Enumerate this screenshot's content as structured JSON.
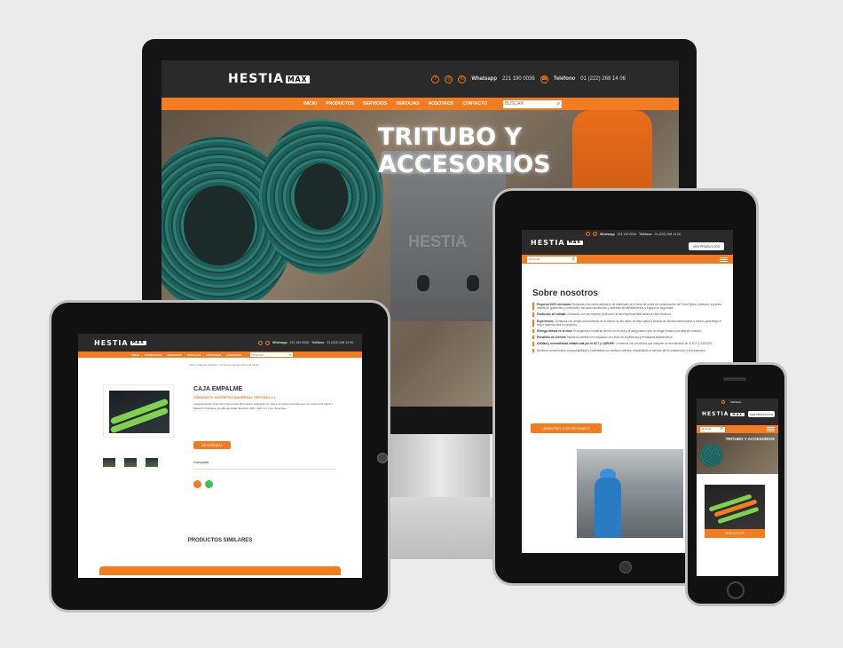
{
  "brand": {
    "logo": "HESTIA",
    "logo_mark": "MAX",
    "accent": "#f47c20"
  },
  "desktop": {
    "whatsapp_label": "Whatsapp",
    "whatsapp": "221 190 0036",
    "phone_label": "Teléfono",
    "phone": "01 (222) 268 14 06",
    "nav": [
      "INICIO",
      "PRODUCTOS",
      "SERVICIOS",
      "VENTAJAS",
      "NOSOTROS",
      "CONTACTO"
    ],
    "search_placeholder": "BUSCAR",
    "hero_title": "TRITUBO Y ACCESORIOS",
    "box_brand": "HESTIA"
  },
  "tablet_left": {
    "breadcrumb": "Inicio / Caja de Registro / Conjunto soporte universal tritubo",
    "product_title": "CAJA EMPALME",
    "product_subtitle": "CONJUNTO SOPORTE UNIVERSAL TRITUBO 4 1",
    "product_desc": "Características: Unión de tritubos para fibra óptica; aplicación en redes de telecomunicaciones con sistema de fijación. Material: Polietileno de alta densidad. Medidas: 300 x 200 mm. Uso: Enterrado.",
    "cta": "ME INTERESA",
    "share": "Compartir",
    "similar": "PRODUCTOS SIMILARES"
  },
  "tablet_right": {
    "catalog_button": "VER PRODUCTOS",
    "heading": "Sobre nosotros",
    "items": [
      {
        "title": "Empresa 100% mexicana:",
        "text": "Dedicada a la comercialización de materiales en el área de redes de comunicación de Fibra Óptica, plásticos, soportes metálicos, gabinetes y conectores; así como accesorios y sistemas de señalamientos y equipo de seguridad."
      },
      {
        "title": "Productos de calidad:",
        "text": "Contamos con las mejores productos de las empresas fabricantes a nivel nacional."
      },
      {
        "title": "Experiencia:",
        "text": "Contamos con amplio conocimiento en el diseño de las redes de fibra óptica y tendido de ductos subterráneos y aéreos para elegir el mejor material para su proyecto."
      },
      {
        "title": "Entrega directa en la obra:",
        "text": "Entregamos el material directo en la obra y le aseguramos que no tenga retrasos por falta de material."
      },
      {
        "title": "Portafolio de clientes:",
        "text": "Nuestros clientes nos respaldan con años de experiencia y resultados satisfactorios."
      },
      {
        "title": "Calidad y normatividad establecida por la SCT y CAPUFE:",
        "text": "Contamos con productos que cumplen la normatividad de la SCT y CAPUFE."
      },
      {
        "title": "",
        "text": "Nuestros compromisos, responsabilidad y honestidad con nuestros clientes, respaldando el servicio de la construcción y la proyección."
      }
    ],
    "cta": "¡NUESTRO CONTÁCTANOS!"
  },
  "phone": {
    "catalog_button": "VER PRODUCTOS",
    "hero_title": "TRITUBO Y ACCESORIOS",
    "card_label": "PRODUCTOS"
  }
}
